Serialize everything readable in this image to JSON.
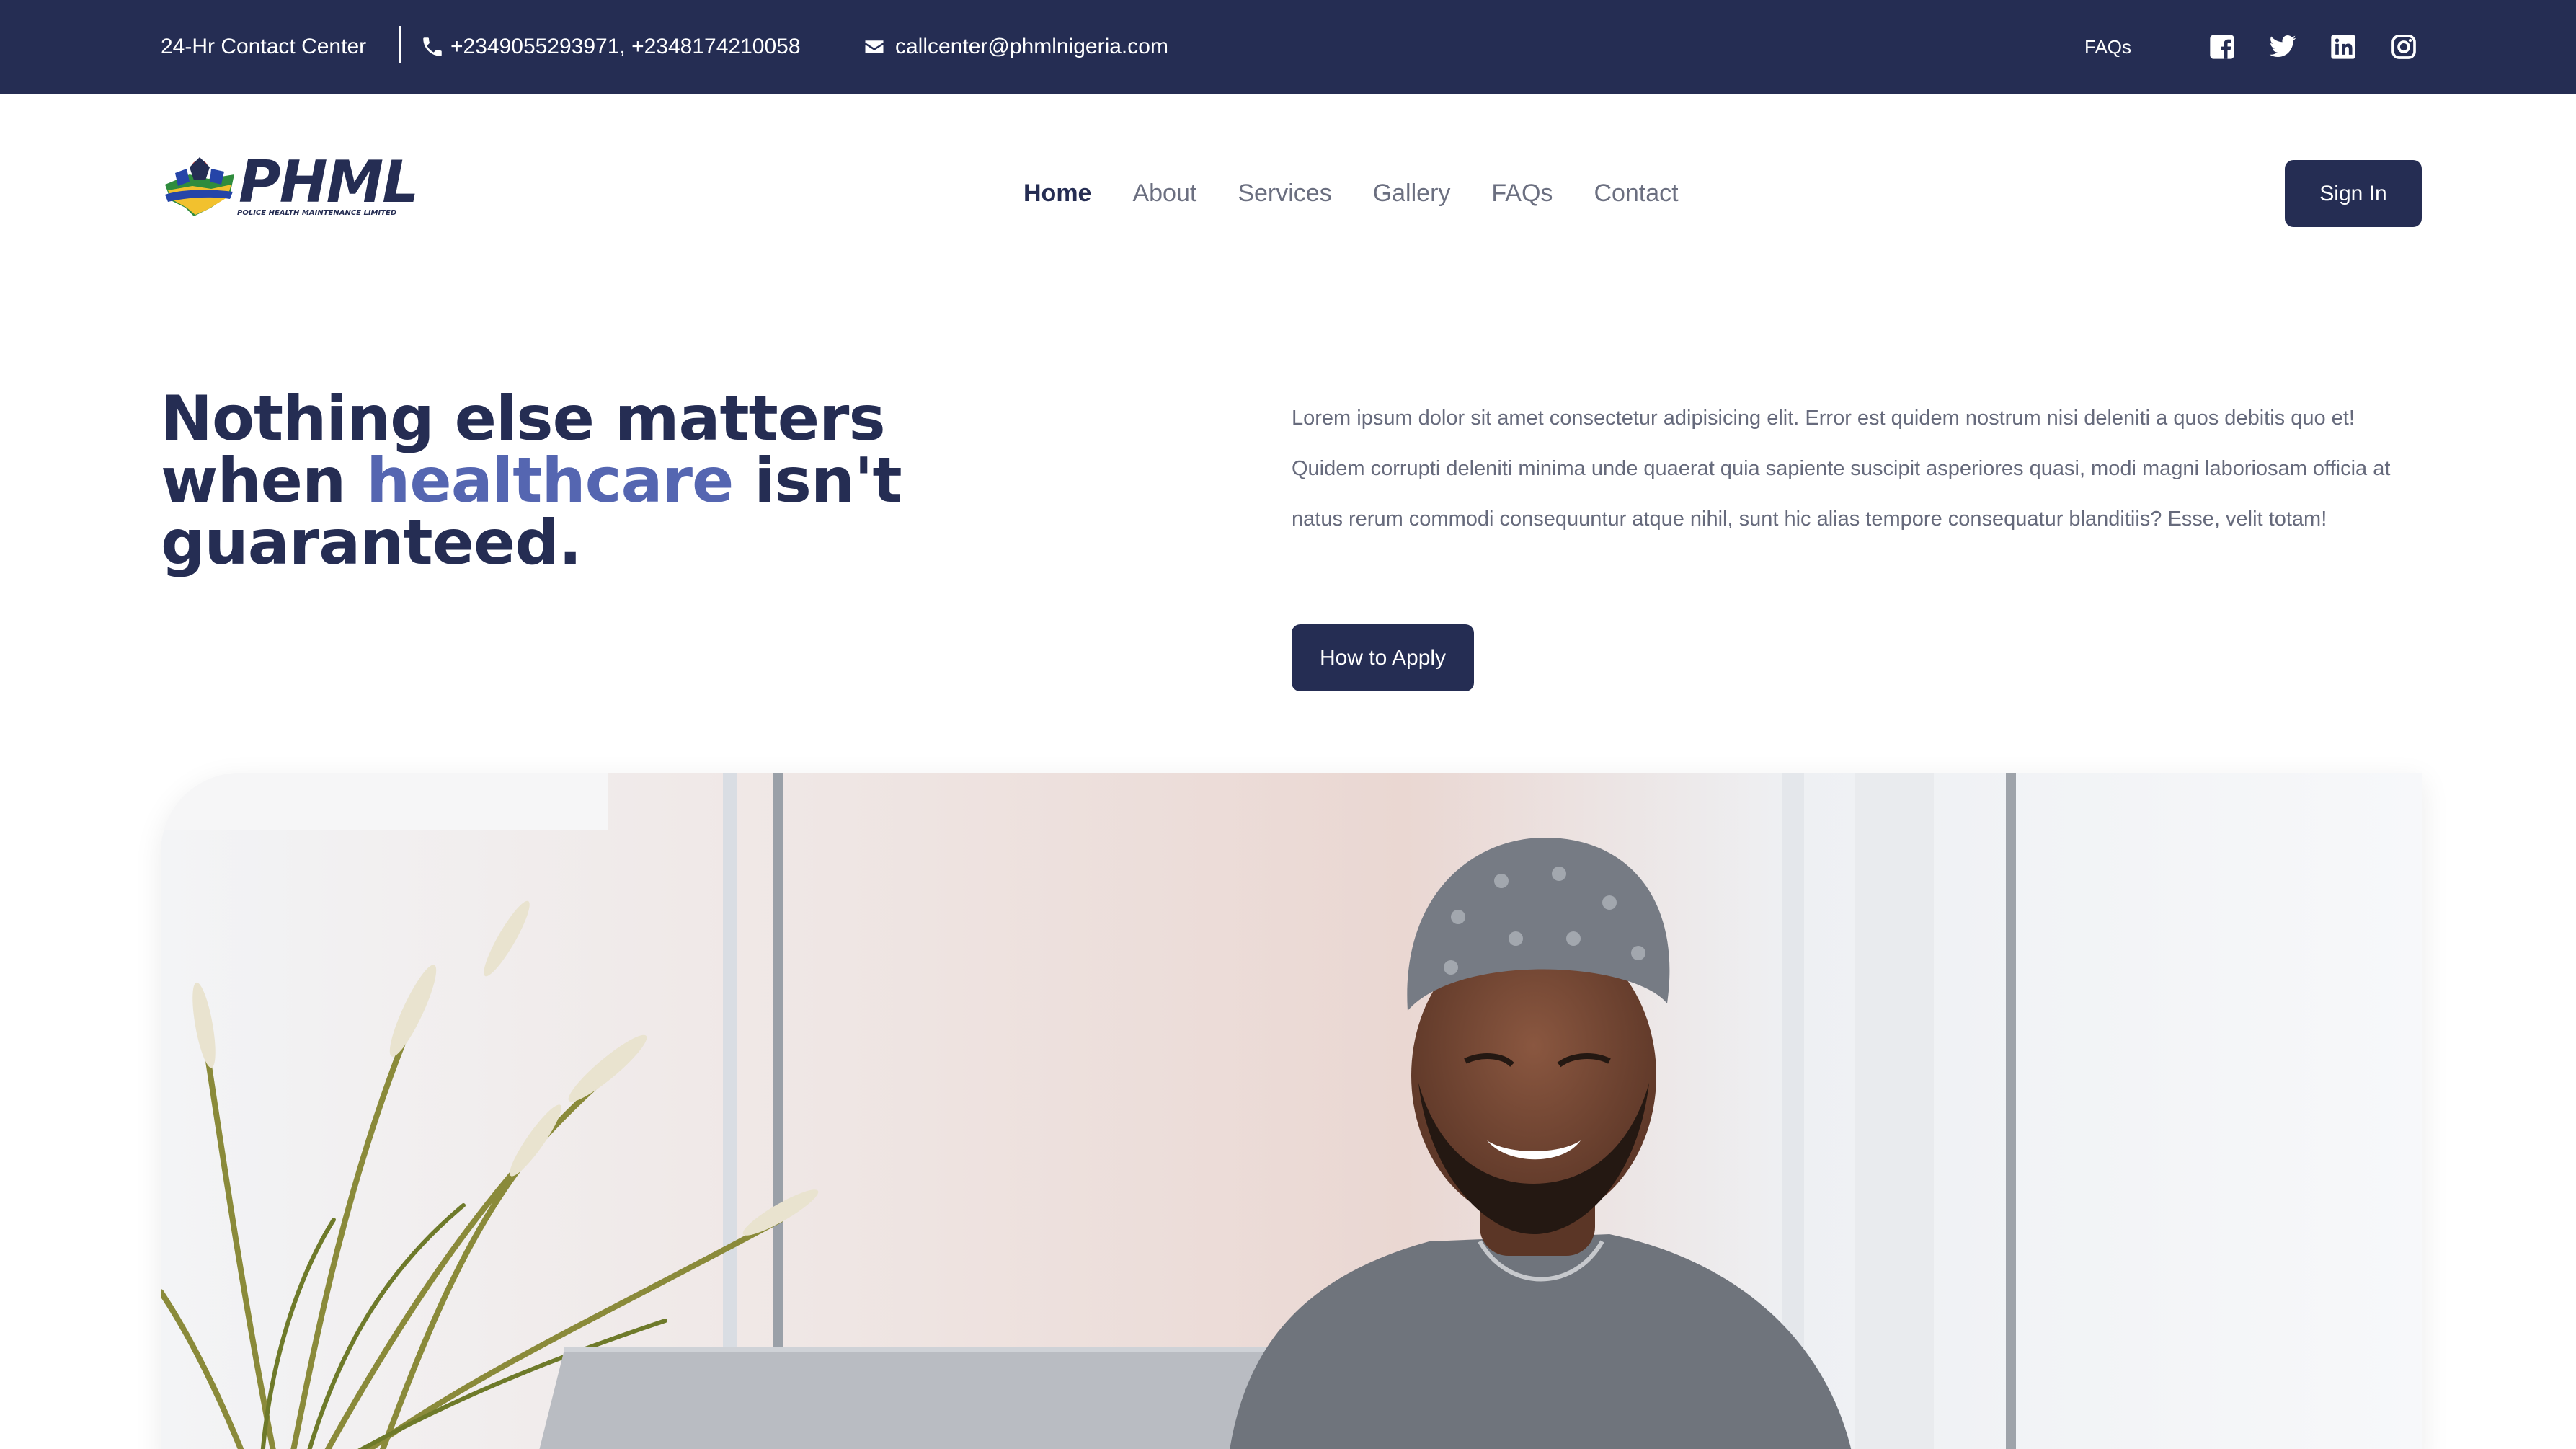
{
  "topbar": {
    "contact_label": "24-Hr Contact Center",
    "phone_icon": "phone-icon",
    "phones": "+2349055293971,  +2348174210058",
    "email_icon": "envelope-icon",
    "email": "callcenter@phmlnigeria.com",
    "faqs": "FAQs",
    "socials": [
      "facebook-icon",
      "twitter-icon",
      "linkedin-icon",
      "instagram-icon"
    ]
  },
  "header": {
    "logo_text": "PHML",
    "logo_subtitle": "POLICE HEALTH MAINTENANCE LIMITED",
    "nav": [
      "Home",
      "About",
      "Services",
      "Gallery",
      "FAQs",
      "Contact"
    ],
    "active_nav": "Home",
    "signin": "Sign In"
  },
  "hero": {
    "title_part1": "Nothing else matters when ",
    "title_accent": "healthcare",
    "title_part2": " isn't guaranteed.",
    "description": "Lorem ipsum dolor sit amet consectetur adipisicing elit. Error est quidem nostrum nisi deleniti a quos debitis quo et! Quidem corrupti deleniti minima unde quaerat quia sapiente suscipit asperiores quasi, modi magni laboriosam officia at natus rerum commodi consequuntur atque nihil, sunt hic alias tempore consequatur blanditiis? Esse, velit totam!",
    "apply_button": "How to Apply"
  },
  "colors": {
    "navy": "#252d53",
    "accent": "#5566b1",
    "muted_text": "#666a7c"
  }
}
